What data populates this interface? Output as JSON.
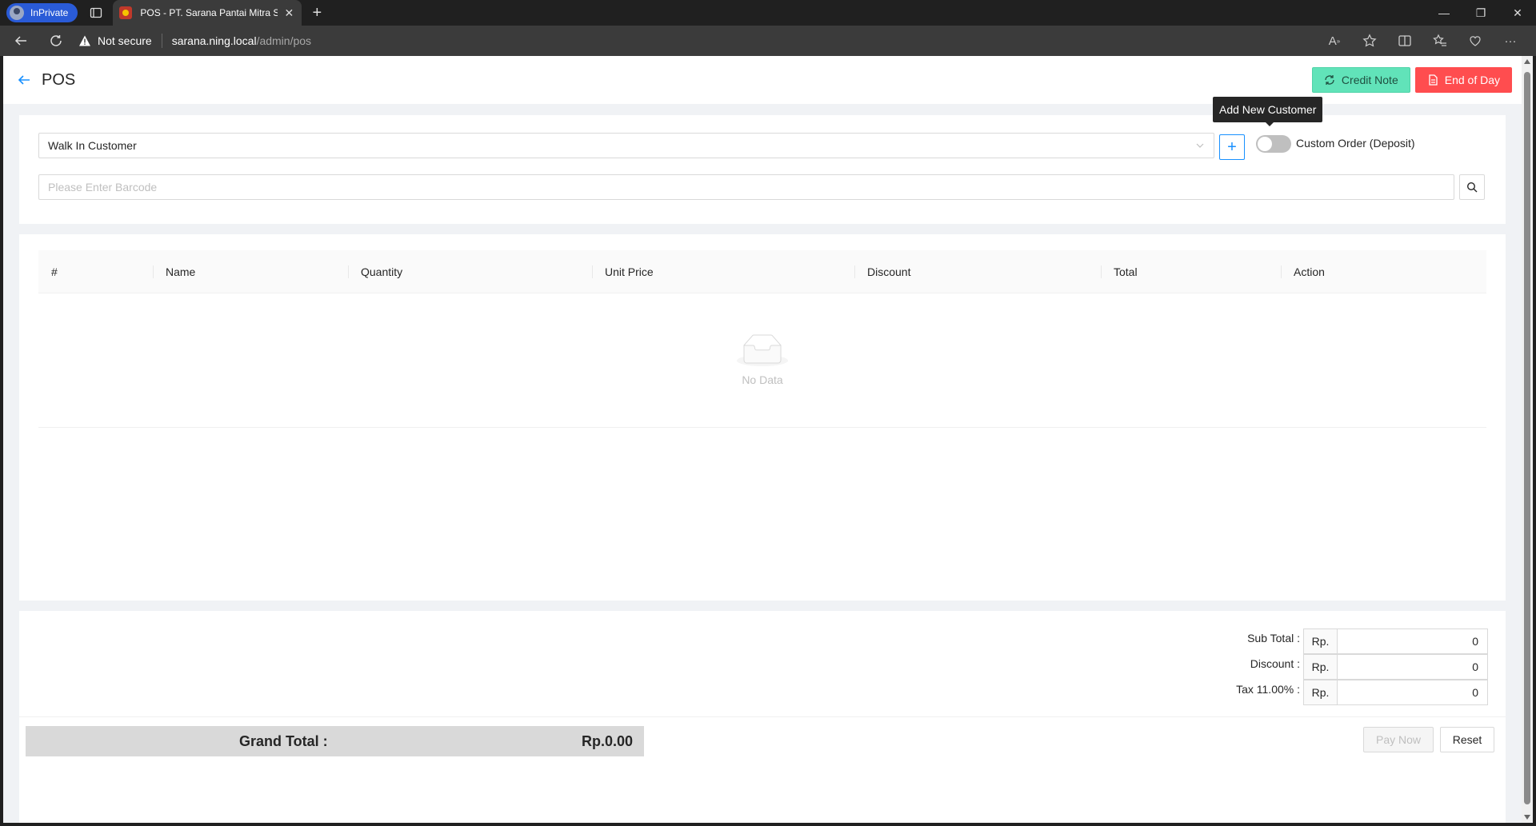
{
  "browser": {
    "inprivate_label": "InPrivate",
    "tab_title": "POS - PT. Sarana Pantai Mitra Se",
    "security_label": "Not secure",
    "url_host": "sarana.ning.local",
    "url_path": "/admin/pos"
  },
  "page": {
    "title": "POS",
    "credit_note_label": "Credit Note",
    "end_of_day_label": "End of Day",
    "tooltip": "Add New Customer"
  },
  "customer": {
    "selected": "Walk In Customer",
    "custom_order_label": "Custom Order (Deposit)",
    "custom_order_enabled": false,
    "barcode_placeholder": "Please Enter Barcode"
  },
  "table": {
    "columns": [
      "#",
      "Name",
      "Quantity",
      "Unit Price",
      "Discount",
      "Total",
      "Action"
    ],
    "rows": [],
    "empty_text": "No Data"
  },
  "totals": {
    "subtotal_label": "Sub Total :",
    "subtotal_prefix": "Rp.",
    "subtotal_value": "0",
    "discount_label": "Discount :",
    "discount_prefix": "Rp.",
    "discount_value": "0",
    "tax_label": "Tax 11.00% :",
    "tax_prefix": "Rp.",
    "tax_value": "0",
    "grand_label": "Grand Total :",
    "grand_value": "Rp.0.00"
  },
  "actions": {
    "pay_now_label": "Pay Now",
    "reset_label": "Reset"
  },
  "colors": {
    "primary": "#1890ff",
    "credit_note_bg": "#61e3b9",
    "end_of_day_bg": "#ff4d4f",
    "inprivate_bg": "#2a5bd7"
  }
}
